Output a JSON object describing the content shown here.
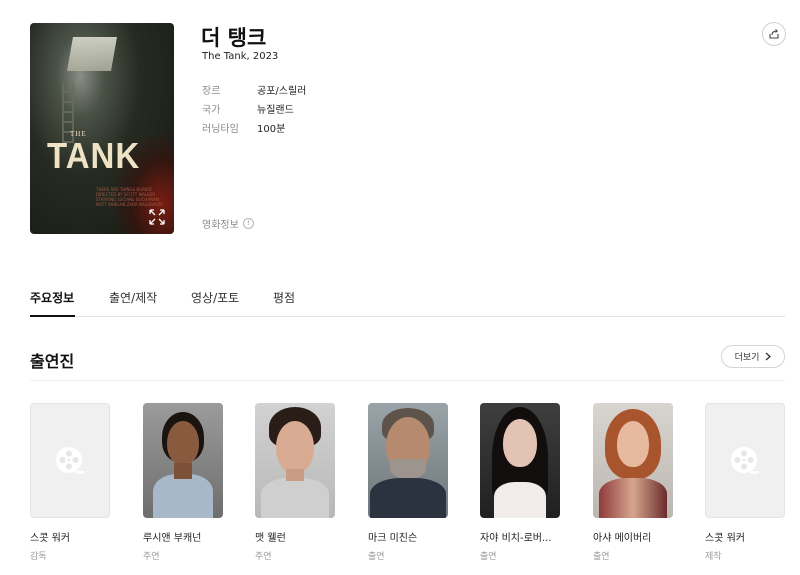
{
  "movie": {
    "title": "더 탱크",
    "subtitle": "The Tank, 2023",
    "poster": {
      "small_title": "THE",
      "big_title": "TANK",
      "tagline": "THERE ARE THINGS BURIED",
      "credits": "DIRECTED BY SCOTT WALKER STARRING LUCIANE BUCHANAN MATT WHELAN ZARA NAUSBAUM"
    },
    "meta": [
      {
        "label": "장르",
        "value": "공포/스릴러"
      },
      {
        "label": "국가",
        "value": "뉴질랜드"
      },
      {
        "label": "러닝타임",
        "value": "100분"
      }
    ],
    "info_label": "영화정보",
    "info_icon_glyph": "!"
  },
  "tabs": [
    {
      "label": "주요정보",
      "active": true
    },
    {
      "label": "출연/제작",
      "active": false
    },
    {
      "label": "영상/포토",
      "active": false
    },
    {
      "label": "평점",
      "active": false
    }
  ],
  "cast_section": {
    "title": "출연진",
    "more_label": "더보기"
  },
  "cast": [
    {
      "name": "스콧 워커",
      "role": "감독",
      "photo": "placeholder"
    },
    {
      "name": "루시앤 부캐넌",
      "role": "주연",
      "photo": "portrait"
    },
    {
      "name": "맷 웰런",
      "role": "주연",
      "photo": "portrait"
    },
    {
      "name": "마크 미친슨",
      "role": "출연",
      "photo": "portrait"
    },
    {
      "name": "자야 비치-로버...",
      "role": "출연",
      "photo": "portrait"
    },
    {
      "name": "아샤 메이버리",
      "role": "출연",
      "photo": "portrait"
    },
    {
      "name": "스콧 워커",
      "role": "제작",
      "photo": "placeholder"
    }
  ],
  "colors": {
    "text_primary": "#111111",
    "text_muted": "#8a8a8a",
    "divider": "#e3e3e3",
    "placeholder_bg": "#f0f0f1"
  }
}
